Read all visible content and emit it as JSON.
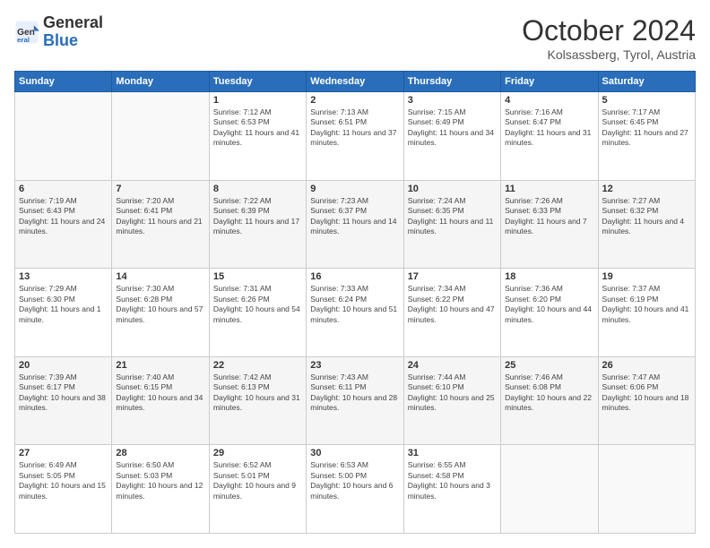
{
  "logo": {
    "text_general": "General",
    "text_blue": "Blue"
  },
  "header": {
    "month": "October 2024",
    "location": "Kolsassberg, Tyrol, Austria"
  },
  "weekdays": [
    "Sunday",
    "Monday",
    "Tuesday",
    "Wednesday",
    "Thursday",
    "Friday",
    "Saturday"
  ],
  "weeks": [
    [
      {
        "day": "",
        "sunrise": "",
        "sunset": "",
        "daylight": ""
      },
      {
        "day": "",
        "sunrise": "",
        "sunset": "",
        "daylight": ""
      },
      {
        "day": "1",
        "sunrise": "Sunrise: 7:12 AM",
        "sunset": "Sunset: 6:53 PM",
        "daylight": "Daylight: 11 hours and 41 minutes."
      },
      {
        "day": "2",
        "sunrise": "Sunrise: 7:13 AM",
        "sunset": "Sunset: 6:51 PM",
        "daylight": "Daylight: 11 hours and 37 minutes."
      },
      {
        "day": "3",
        "sunrise": "Sunrise: 7:15 AM",
        "sunset": "Sunset: 6:49 PM",
        "daylight": "Daylight: 11 hours and 34 minutes."
      },
      {
        "day": "4",
        "sunrise": "Sunrise: 7:16 AM",
        "sunset": "Sunset: 6:47 PM",
        "daylight": "Daylight: 11 hours and 31 minutes."
      },
      {
        "day": "5",
        "sunrise": "Sunrise: 7:17 AM",
        "sunset": "Sunset: 6:45 PM",
        "daylight": "Daylight: 11 hours and 27 minutes."
      }
    ],
    [
      {
        "day": "6",
        "sunrise": "Sunrise: 7:19 AM",
        "sunset": "Sunset: 6:43 PM",
        "daylight": "Daylight: 11 hours and 24 minutes."
      },
      {
        "day": "7",
        "sunrise": "Sunrise: 7:20 AM",
        "sunset": "Sunset: 6:41 PM",
        "daylight": "Daylight: 11 hours and 21 minutes."
      },
      {
        "day": "8",
        "sunrise": "Sunrise: 7:22 AM",
        "sunset": "Sunset: 6:39 PM",
        "daylight": "Daylight: 11 hours and 17 minutes."
      },
      {
        "day": "9",
        "sunrise": "Sunrise: 7:23 AM",
        "sunset": "Sunset: 6:37 PM",
        "daylight": "Daylight: 11 hours and 14 minutes."
      },
      {
        "day": "10",
        "sunrise": "Sunrise: 7:24 AM",
        "sunset": "Sunset: 6:35 PM",
        "daylight": "Daylight: 11 hours and 11 minutes."
      },
      {
        "day": "11",
        "sunrise": "Sunrise: 7:26 AM",
        "sunset": "Sunset: 6:33 PM",
        "daylight": "Daylight: 11 hours and 7 minutes."
      },
      {
        "day": "12",
        "sunrise": "Sunrise: 7:27 AM",
        "sunset": "Sunset: 6:32 PM",
        "daylight": "Daylight: 11 hours and 4 minutes."
      }
    ],
    [
      {
        "day": "13",
        "sunrise": "Sunrise: 7:29 AM",
        "sunset": "Sunset: 6:30 PM",
        "daylight": "Daylight: 11 hours and 1 minute."
      },
      {
        "day": "14",
        "sunrise": "Sunrise: 7:30 AM",
        "sunset": "Sunset: 6:28 PM",
        "daylight": "Daylight: 10 hours and 57 minutes."
      },
      {
        "day": "15",
        "sunrise": "Sunrise: 7:31 AM",
        "sunset": "Sunset: 6:26 PM",
        "daylight": "Daylight: 10 hours and 54 minutes."
      },
      {
        "day": "16",
        "sunrise": "Sunrise: 7:33 AM",
        "sunset": "Sunset: 6:24 PM",
        "daylight": "Daylight: 10 hours and 51 minutes."
      },
      {
        "day": "17",
        "sunrise": "Sunrise: 7:34 AM",
        "sunset": "Sunset: 6:22 PM",
        "daylight": "Daylight: 10 hours and 47 minutes."
      },
      {
        "day": "18",
        "sunrise": "Sunrise: 7:36 AM",
        "sunset": "Sunset: 6:20 PM",
        "daylight": "Daylight: 10 hours and 44 minutes."
      },
      {
        "day": "19",
        "sunrise": "Sunrise: 7:37 AM",
        "sunset": "Sunset: 6:19 PM",
        "daylight": "Daylight: 10 hours and 41 minutes."
      }
    ],
    [
      {
        "day": "20",
        "sunrise": "Sunrise: 7:39 AM",
        "sunset": "Sunset: 6:17 PM",
        "daylight": "Daylight: 10 hours and 38 minutes."
      },
      {
        "day": "21",
        "sunrise": "Sunrise: 7:40 AM",
        "sunset": "Sunset: 6:15 PM",
        "daylight": "Daylight: 10 hours and 34 minutes."
      },
      {
        "day": "22",
        "sunrise": "Sunrise: 7:42 AM",
        "sunset": "Sunset: 6:13 PM",
        "daylight": "Daylight: 10 hours and 31 minutes."
      },
      {
        "day": "23",
        "sunrise": "Sunrise: 7:43 AM",
        "sunset": "Sunset: 6:11 PM",
        "daylight": "Daylight: 10 hours and 28 minutes."
      },
      {
        "day": "24",
        "sunrise": "Sunrise: 7:44 AM",
        "sunset": "Sunset: 6:10 PM",
        "daylight": "Daylight: 10 hours and 25 minutes."
      },
      {
        "day": "25",
        "sunrise": "Sunrise: 7:46 AM",
        "sunset": "Sunset: 6:08 PM",
        "daylight": "Daylight: 10 hours and 22 minutes."
      },
      {
        "day": "26",
        "sunrise": "Sunrise: 7:47 AM",
        "sunset": "Sunset: 6:06 PM",
        "daylight": "Daylight: 10 hours and 18 minutes."
      }
    ],
    [
      {
        "day": "27",
        "sunrise": "Sunrise: 6:49 AM",
        "sunset": "Sunset: 5:05 PM",
        "daylight": "Daylight: 10 hours and 15 minutes."
      },
      {
        "day": "28",
        "sunrise": "Sunrise: 6:50 AM",
        "sunset": "Sunset: 5:03 PM",
        "daylight": "Daylight: 10 hours and 12 minutes."
      },
      {
        "day": "29",
        "sunrise": "Sunrise: 6:52 AM",
        "sunset": "Sunset: 5:01 PM",
        "daylight": "Daylight: 10 hours and 9 minutes."
      },
      {
        "day": "30",
        "sunrise": "Sunrise: 6:53 AM",
        "sunset": "Sunset: 5:00 PM",
        "daylight": "Daylight: 10 hours and 6 minutes."
      },
      {
        "day": "31",
        "sunrise": "Sunrise: 6:55 AM",
        "sunset": "Sunset: 4:58 PM",
        "daylight": "Daylight: 10 hours and 3 minutes."
      },
      {
        "day": "",
        "sunrise": "",
        "sunset": "",
        "daylight": ""
      },
      {
        "day": "",
        "sunrise": "",
        "sunset": "",
        "daylight": ""
      }
    ]
  ]
}
